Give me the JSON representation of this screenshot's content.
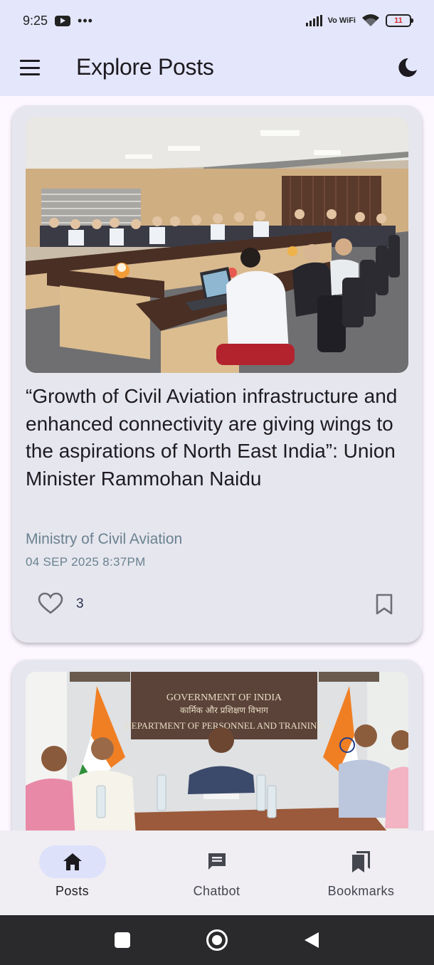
{
  "status_bar": {
    "time": "9:25",
    "dots": "•••",
    "network": "Vo WiFi",
    "battery": "11"
  },
  "app_bar": {
    "title": "Explore Posts",
    "menu_icon": "menu-icon",
    "theme_icon": "moon-icon"
  },
  "posts": [
    {
      "title": "“Growth of Civil Aviation infrastructure and enhanced connectivity are giving wings to the aspirations of North East India”: Union Minister Rammohan Naidu",
      "source": "Ministry of Civil Aviation",
      "date": "04 SEP 2025 8:37PM",
      "likes": "3"
    },
    {
      "sign_line1": "GOVERNMENT OF INDIA",
      "sign_line2": "कार्मिक और प्रशिक्षण विभाग",
      "sign_line3": "DEPARTMENT OF PERSONNEL AND TRAINING"
    }
  ],
  "bottom_nav": [
    {
      "label": "Posts",
      "icon": "home-icon",
      "active": true
    },
    {
      "label": "Chatbot",
      "icon": "chat-icon",
      "active": false
    },
    {
      "label": "Bookmarks",
      "icon": "bookmarks-icon",
      "active": false
    }
  ],
  "colors": {
    "app_bar_bg": "#e4e6fb",
    "card_bg": "#e6e6ee",
    "source_text": "#6a8290",
    "active_pill": "#dde1fa"
  }
}
